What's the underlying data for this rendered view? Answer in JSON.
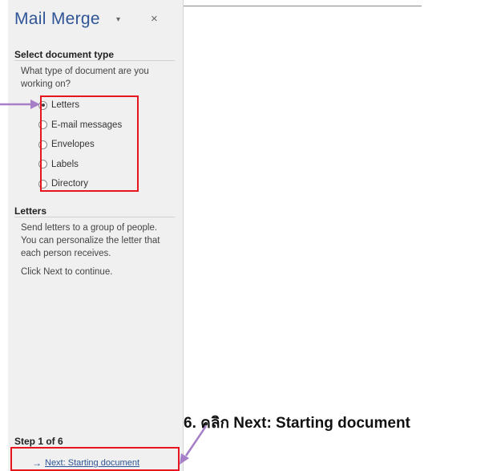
{
  "pane": {
    "title": "Mail Merge",
    "dropdown_icon": "chevron-down-icon",
    "close_icon": "close-icon",
    "close_glyph": "×",
    "dropdown_glyph": "▾"
  },
  "select_type": {
    "heading": "Select document type",
    "question": "What type of document are you working on?",
    "options": [
      {
        "label": "Letters",
        "checked": true
      },
      {
        "label": "E-mail messages",
        "checked": false
      },
      {
        "label": "Envelopes",
        "checked": false
      },
      {
        "label": "Labels",
        "checked": false
      },
      {
        "label": "Directory",
        "checked": false
      }
    ]
  },
  "letters_section": {
    "heading": "Letters",
    "description": "Send letters to a group of people. You can personalize the letter that each person receives.",
    "hint": "Click Next to continue."
  },
  "footer": {
    "step": "Step 1 of 6",
    "next_arrow": "→",
    "next_label": "Next: Starting document"
  },
  "annotation": {
    "instruction": "6. คลิก Next: Starting document",
    "highlight_color": "#e8141e",
    "arrow_color": "#a77ec8"
  }
}
